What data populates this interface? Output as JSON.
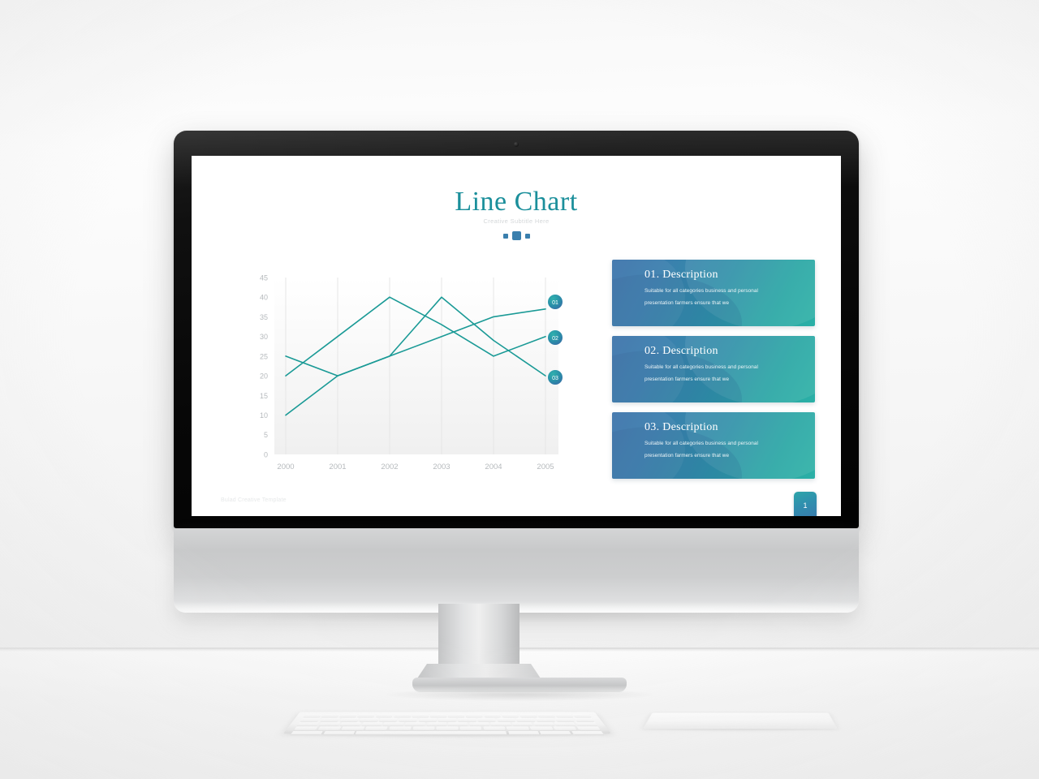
{
  "scene": {
    "device": "desktop-monitor",
    "accessories": [
      "keyboard",
      "trackpad"
    ]
  },
  "slide": {
    "title": "Line Chart",
    "subtitle": "Creative Subtitle Here",
    "footer": "Bulad Creative Template",
    "slide_number": "1",
    "accent_teal": "#1b8f9b",
    "accent_blue": "#3a7fad",
    "line_color": "#1a9a96"
  },
  "chart_data": {
    "type": "line",
    "title": "Line Chart",
    "xlabel": "",
    "ylabel": "",
    "categories": [
      "2000",
      "2001",
      "2002",
      "2003",
      "2004",
      "2005"
    ],
    "x_ticks": [
      "2000",
      "2001",
      "2002",
      "2003",
      "2004",
      "2005"
    ],
    "y_ticks": [
      0,
      5,
      10,
      15,
      20,
      25,
      30,
      35,
      40,
      45
    ],
    "ylim": [
      0,
      45
    ],
    "grid": "vertical-only",
    "legend_position": "line-end-badges",
    "series": [
      {
        "name": "01",
        "label": "01",
        "values": [
          10,
          20,
          25,
          30,
          35,
          37
        ]
      },
      {
        "name": "02",
        "label": "02",
        "values": [
          20,
          30,
          40,
          33,
          25,
          30
        ]
      },
      {
        "name": "03",
        "label": "03",
        "values": [
          25,
          20,
          25,
          40,
          29,
          20
        ]
      }
    ],
    "annotations": [
      {
        "text": "01",
        "at_x": "2005",
        "at_y": 37
      },
      {
        "text": "02",
        "at_x": "2005",
        "at_y": 30
      },
      {
        "text": "03",
        "at_x": "2005",
        "at_y": 20
      }
    ]
  },
  "cards": [
    {
      "title": "01. Description",
      "line1": "Suitable for all categories business and personal",
      "line2": "presentation farmers ensure that we"
    },
    {
      "title": "02. Description",
      "line1": "Suitable for all categories business and personal",
      "line2": "presentation farmers ensure that we"
    },
    {
      "title": "03. Description",
      "line1": "Suitable for all categories business and personal",
      "line2": "presentation farmers ensure that we"
    }
  ]
}
